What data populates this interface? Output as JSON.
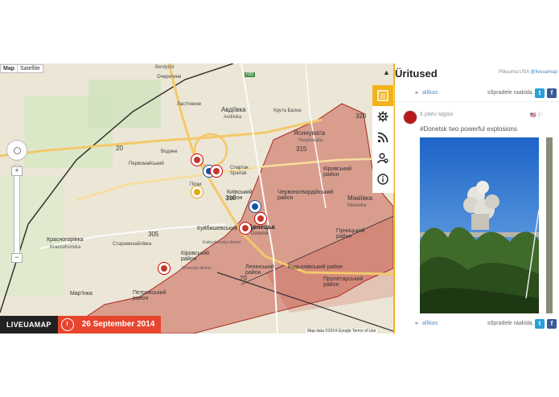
{
  "map": {
    "type_controls": [
      "Map",
      "Satellite"
    ],
    "zoom_in": "+",
    "zoom_out": "−",
    "attribution": "Map data ©2014 Google   Terms of Use",
    "labels": {
      "avdiivka": "Авдіївка",
      "avdiivka_lat": "Avdiivka",
      "spartak": "Спартак",
      "spartak_lat": "Spartak",
      "yasynuvata": "Ясинувата",
      "yasynuvata_lat": "Yasynuvata",
      "kirovskyi_ne": "Кіровський район",
      "makiivka": "Макіївка",
      "makiivka_lat": "Makiivka",
      "chervonohvardiiskyi": "Червоногвардійський район",
      "kyivskyi": "Київський район",
      "kuibyshevskyi": "Куйбишевський район",
      "kuibyshevskyi_lat": "Kuibyshevskyi district",
      "donetsk": "Донецьк",
      "donetsk_lat": "Donetsk",
      "kirovskyi_w": "Кіровський район",
      "kirovskyi_w_lat": "Kirovs'kyi district",
      "hirnytskyi": "Гірницький район",
      "leninskyi": "Ленінський район",
      "budionivskyi": "Будьонівський район",
      "petrovskyi": "Петровський район",
      "proletarskyi": "Пролетарський район",
      "krasnohorivka": "Красногорівка",
      "krasnohorivka_lat": "Krasnohorivka",
      "marinka": "Мар'їнка",
      "pervomaiskyi": "Первомайський",
      "vodiane": "Водяне",
      "pisky": "Піски",
      "staromykhailivka": "Старомихайлівка",
      "berdychi": "Berdychi",
      "lastochkyne": "Ластічкине",
      "ocheretyne": "Очеретине",
      "kruta_balka": "Крута Балка",
      "road_20": "20",
      "road_315": "315",
      "road_320": "320",
      "road_305": "305",
      "road_310": "310",
      "road_70": "70",
      "road_h20": "H20"
    }
  },
  "footer": {
    "logo": "LIVEUAMAP",
    "date": "26 September 2014"
  },
  "sidebar": {
    "title": "Üritused",
    "subtitle_prefix": "Piiksuma:USA",
    "subtitle_handle": "@liveuamap",
    "top_source": "allikas",
    "top_share": "sõpradele raakida.",
    "post": {
      "time": "6 päev tagasi",
      "text": "#Donetsk two powerful explosions",
      "source": "allikas",
      "share": "sõpradele raakida."
    }
  },
  "colors": {
    "accent": "#f2b21b",
    "occupied": "#c0392b",
    "date_bg": "#e8452f",
    "twitter": "#2a9fd8",
    "facebook": "#3b5998"
  }
}
